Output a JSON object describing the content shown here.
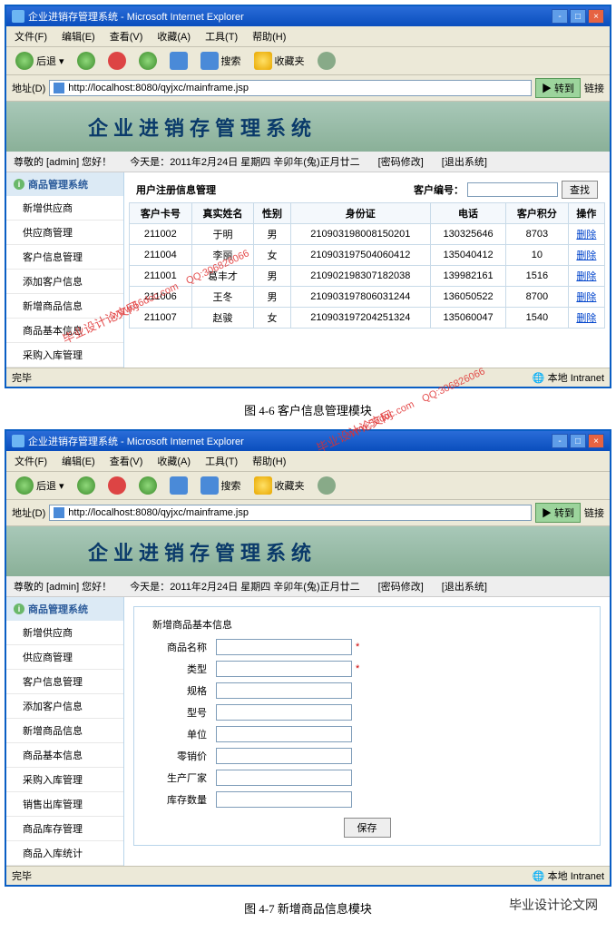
{
  "window": {
    "title": "企业进销存管理系统 - Microsoft Internet Explorer",
    "url": "http://localhost:8080/qyjxc/mainframe.jsp"
  },
  "menu": [
    "文件(F)",
    "编辑(E)",
    "查看(V)",
    "收藏(A)",
    "工具(T)",
    "帮助(H)"
  ],
  "toolbar": {
    "back": "后退",
    "search": "搜索",
    "fav": "收藏夹"
  },
  "address": {
    "label": "地址(D)",
    "go": "转到",
    "links": "链接"
  },
  "banner": {
    "title": "企业进销存管理系统"
  },
  "sysbar": {
    "greeting": "尊敬的 [admin] 您好！",
    "date_label": "今天是：",
    "date": "2011年2月24日 星期四 辛卯年(兔)正月廿二",
    "pwd": "[密码修改]",
    "logout": "[退出系统]"
  },
  "sidebar": {
    "title": "商品管理系统",
    "items1": [
      "新增供应商",
      "供应商管理",
      "客户信息管理",
      "添加客户信息",
      "新增商品信息",
      "商品基本信息",
      "采购入库管理"
    ],
    "items2": [
      "新增供应商",
      "供应商管理",
      "客户信息管理",
      "添加客户信息",
      "新增商品信息",
      "商品基本信息",
      "采购入库管理",
      "销售出库管理",
      "商品库存管理",
      "商品入库统计"
    ]
  },
  "table": {
    "title": "用户注册信息管理",
    "search_label": "客户编号：",
    "search_btn": "查找",
    "headers": [
      "客户卡号",
      "真实姓名",
      "性别",
      "身份证",
      "电话",
      "客户积分",
      "操作"
    ],
    "rows": [
      [
        "211002",
        "于明",
        "男",
        "210903198008150201",
        "130325646",
        "8703",
        "删除"
      ],
      [
        "211004",
        "李丽",
        "女",
        "210903197504060412",
        "135040412",
        "10",
        "删除"
      ],
      [
        "211001",
        "葛丰才",
        "男",
        "210902198307182038",
        "139982161",
        "1516",
        "删除"
      ],
      [
        "211006",
        "王冬",
        "男",
        "210903197806031244",
        "136050522",
        "8700",
        "删除"
      ],
      [
        "211007",
        "赵骏",
        "女",
        "210903197204251324",
        "135060047",
        "1540",
        "删除"
      ]
    ]
  },
  "form": {
    "title": "新增商品基本信息",
    "fields": [
      {
        "label": "商品名称",
        "req": true
      },
      {
        "label": "类型",
        "req": true
      },
      {
        "label": "规格",
        "req": false
      },
      {
        "label": "型号",
        "req": false
      },
      {
        "label": "单位",
        "req": false
      },
      {
        "label": "零销价",
        "req": false
      },
      {
        "label": "生产厂家",
        "req": false
      },
      {
        "label": "库存数量",
        "req": false
      }
    ],
    "save_btn": "保存"
  },
  "status": {
    "done": "完毕",
    "zone": "本地 Intranet"
  },
  "captions": {
    "fig46": "图 4-6 客户信息管理模块",
    "fig47": "图 4-7 新增商品信息模块"
  },
  "watermarks": {
    "url": "www.56doc.com",
    "qq": "QQ:306826066"
  },
  "footer_brand": "毕业设计论文网"
}
